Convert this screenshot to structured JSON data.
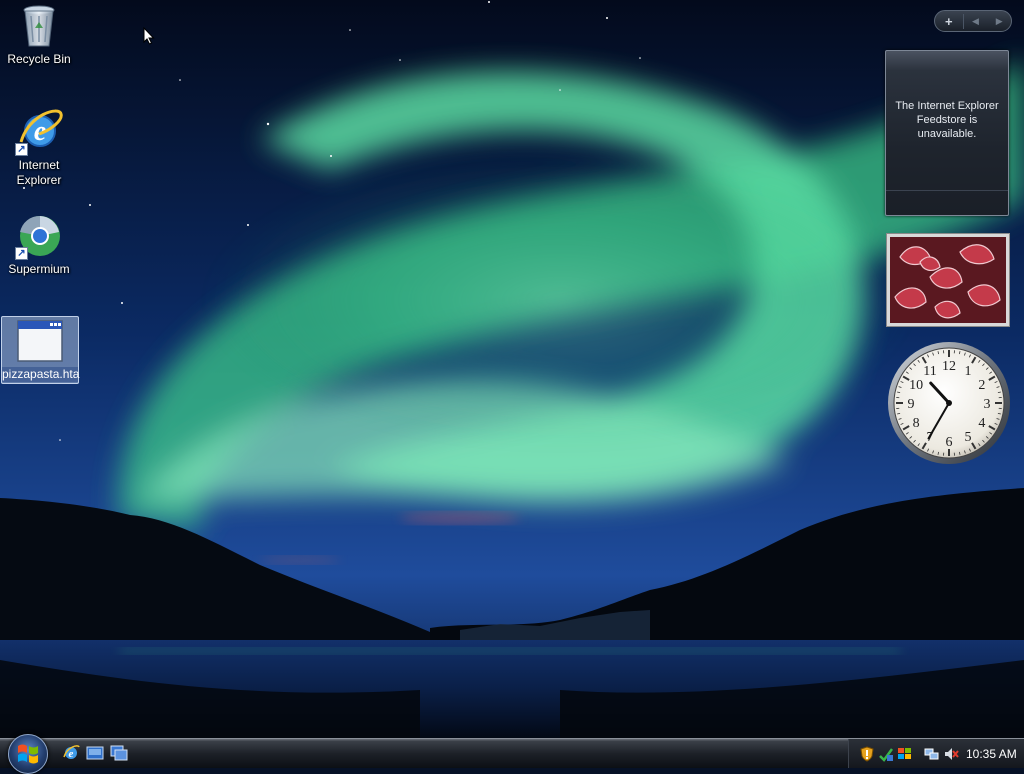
{
  "desktop": {
    "icons": [
      {
        "label": "Recycle Bin",
        "icon": "recycle-bin-icon"
      },
      {
        "label": "Internet\nExplorer",
        "icon": "internet-explorer-icon"
      },
      {
        "label": "Supermium",
        "icon": "supermium-browser-icon"
      },
      {
        "label": "pizzapasta.hta",
        "icon": "hta-application-icon",
        "selected": true
      }
    ]
  },
  "sidebar": {
    "controls": {
      "add_label": "+",
      "prev_label": "◀",
      "next_label": "▶"
    },
    "feed_gadget": {
      "message": "The Internet Explorer Feedstore is unavailable."
    },
    "slideshow_gadget": {
      "subject": "red-frosted-leaves-photo"
    },
    "clock_gadget": {
      "numbers": [
        "12",
        "1",
        "2",
        "3",
        "4",
        "5",
        "6",
        "7",
        "8",
        "9",
        "10",
        "11"
      ],
      "time": "10:35"
    }
  },
  "taskbar": {
    "start_icon": "windows-logo-icon",
    "quick_launch": [
      "internet-explorer-icon",
      "show-desktop-icon",
      "switch-windows-icon"
    ],
    "tray_icons": [
      "security-shield-icon",
      "windows-update-icon",
      "network-icon",
      "network-connection-icon",
      "volume-muted-icon"
    ],
    "clock": "10:35 AM"
  },
  "colors": {
    "aurora": "#4be3a0",
    "sky_top": "#030b1e",
    "sky_mid": "#0f2f6e",
    "taskbar": "#1d2128"
  }
}
